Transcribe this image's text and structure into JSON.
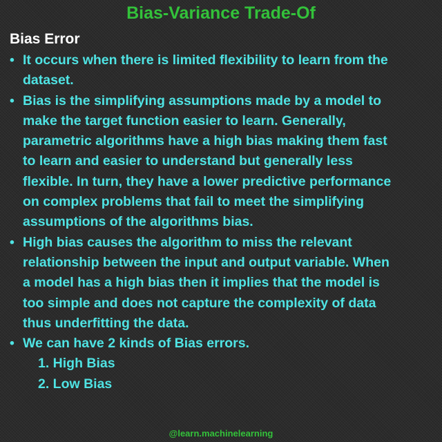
{
  "colors": {
    "title": "#33c23a",
    "body_text": "#4fe3e3",
    "heading": "#ffffff",
    "footer": "#33c23a",
    "background": "#2b2b2b"
  },
  "title": "Bias-Variance Trade-Of",
  "section_heading": "Bias Error",
  "bullet_symbol": "•",
  "bullets": [
    {
      "lines": [
        "It occurs when there is limited flexibility to learn from the",
        "dataset."
      ]
    },
    {
      "lines": [
        "Bias is the simplifying assumptions made by a model to",
        "make the target function easier to learn. Generally,",
        "parametric algorithms have a high bias making them fast",
        "to learn and easier to understand but generally less",
        "flexible. In turn, they have a lower predictive performance",
        "on complex problems that fail to meet the simplifying",
        "assumptions of the algorithms bias."
      ]
    },
    {
      "lines": [
        "High bias causes the algorithm to miss the relevant",
        "relationship between the input and output variable. When",
        "a model has a high bias then it implies that the model is",
        "too simple and does not capture the complexity of data",
        "thus underfitting the data."
      ]
    },
    {
      "lines": [
        "We can have 2 kinds of Bias errors."
      ],
      "subitems": [
        "1. High Bias",
        "2. Low Bias"
      ]
    }
  ],
  "footer": "@learn.machinelearning"
}
